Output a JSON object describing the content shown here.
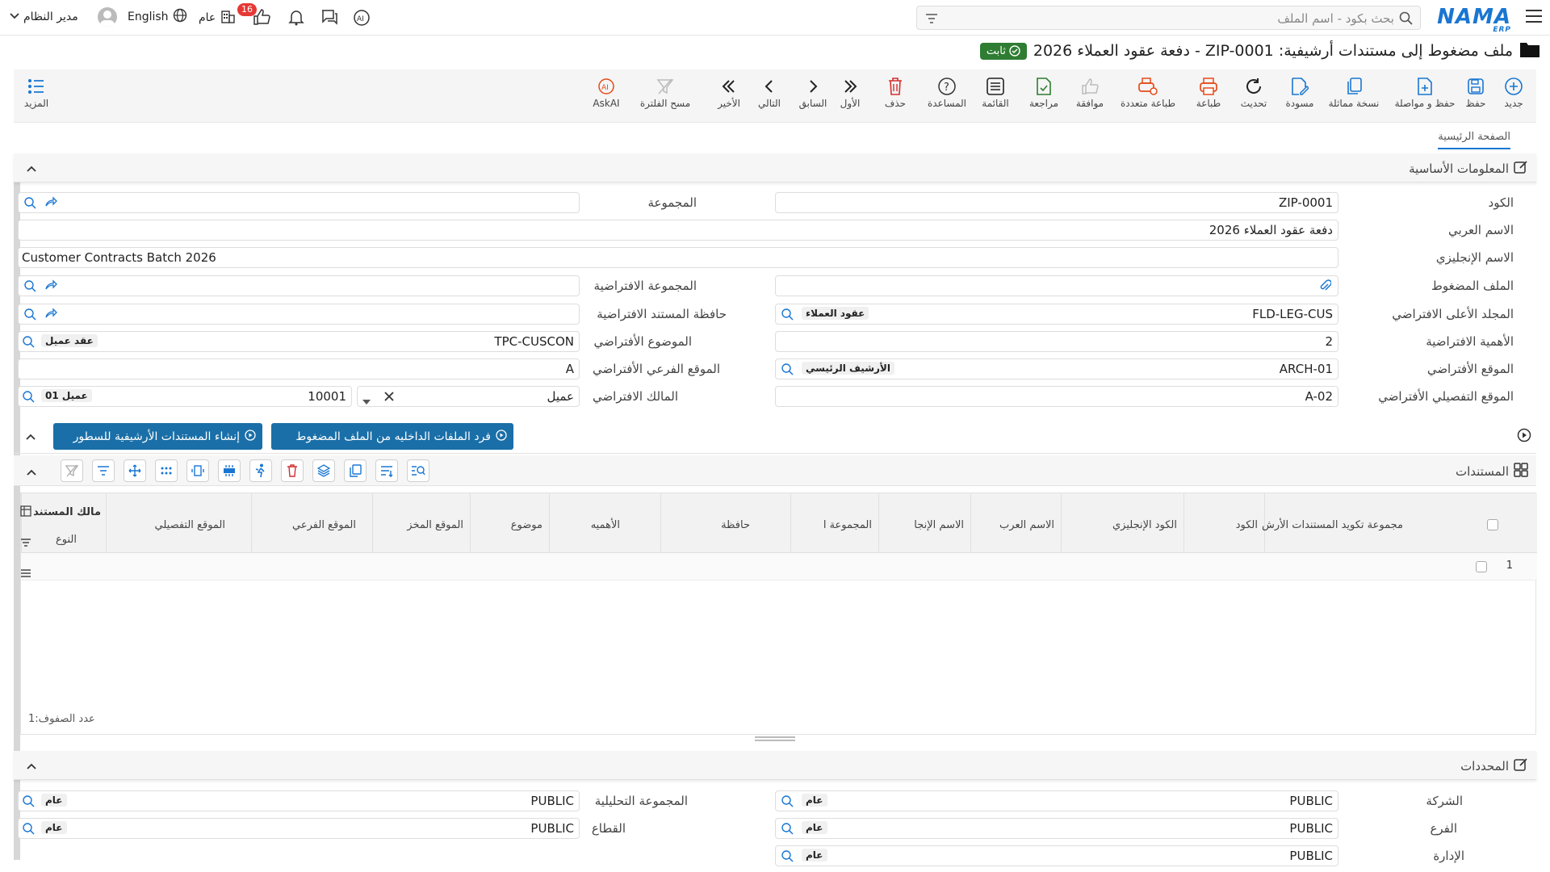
{
  "topbar": {
    "search_placeholder": "بحث بكود - اسم الملف",
    "logo": "NAMA",
    "logo_sub": "ERP",
    "user_name": "مدير النظام",
    "language": "English",
    "scope": "عام",
    "notif_count": "16"
  },
  "page": {
    "title": "ملف مضغوط إلى مستندات أرشيفية: ZIP-0001 - دفعة عقود العملاء 2026",
    "status": "ثابت"
  },
  "toolbar": {
    "new": "جديد",
    "save": "حفظ",
    "save_continue": "حفظ و مواصلة",
    "duplicate": "نسخة مماثلة",
    "draft": "مسودة",
    "refresh": "تحديث",
    "print": "طباعة",
    "multi_print": "طباعة متعددة",
    "approve": "موافقة",
    "review": "مراجعة",
    "list": "القائمة",
    "help": "المساعدة",
    "delete": "حذف",
    "first": "الأول",
    "prev": "السابق",
    "next": "التالي",
    "last": "الأخير",
    "clear_filter": "مسح الفلترة",
    "askai": "AskAI",
    "more": "المزيد"
  },
  "tabs": {
    "main": "الصفحة الرئيسية"
  },
  "basic": {
    "title": "المعلومات الأساسية",
    "code_label": "الكود",
    "code": "ZIP-0001",
    "group_label": "المجموعة",
    "arabic_name_label": "الاسم العربي",
    "arabic_name": "دفعة عقود العملاء 2026",
    "english_name_label": "الاسم الإنجليزي",
    "english_name": "Customer Contracts Batch 2026",
    "zip_file_label": "الملف المضغوط",
    "default_group_label": "المجموعة الافتراضية",
    "default_parent_folder_label": "المجلد الأعلى الافتراضي",
    "default_parent_folder": "FLD-LEG-CUS",
    "default_parent_folder_tag": "عقود العملاء",
    "default_doc_holder_label": "حافظة المستند الافتراضية",
    "default_importance_label": "الأهمية الافتراضية",
    "default_importance": "2",
    "default_subject_label": "الموضوع الأفتراضي",
    "default_subject": "TPC-CUSCON",
    "default_subject_tag": "عقد عميل",
    "default_location_label": "الموقع الأفتراضي",
    "default_location": "ARCH-01",
    "default_location_tag": "الأرشيف الرئيسي",
    "default_sublocation_label": "الموقع الفرعي الأفتراضي",
    "default_sublocation": "A",
    "default_detail_location_label": "الموقع التفصيلي الأفتراضي",
    "default_detail_location": "A-02",
    "default_owner_label": "المالك الافتراضي",
    "default_owner_type": "عميل",
    "default_owner": "10001",
    "default_owner_tag": "عميل 01"
  },
  "actions": {
    "extract": "فرد الملفات الداخليه من الملف المضغوط",
    "create_docs": "إنشاء المستندات الأرشيفية للسطور"
  },
  "documents": {
    "title": "المستندات",
    "columns": [
      "مجموعة تكويد المستندات الأرش",
      "الكود",
      "الكود الإنجليزي",
      "الاسم العرب",
      "الاسم الإنجا",
      "المجموعة ا",
      "حافظة",
      "الأهميه",
      "موضوع",
      "الموقع المخز",
      "الموقع الفرعي",
      "الموقع التفصيلي",
      "مالك المستند"
    ],
    "type_col": "النوع",
    "row_number": "1",
    "rows_count_label": "عدد الصفوف:",
    "rows_count": "1"
  },
  "dims": {
    "title": "المحددات",
    "company_label": "الشركة",
    "company": "PUBLIC",
    "company_tag": "عام",
    "branch_label": "الفرع",
    "branch": "PUBLIC",
    "branch_tag": "عام",
    "dept_label": "الإدارة",
    "dept": "PUBLIC",
    "dept_tag": "عام",
    "analytic_label": "المجموعة التحليلية",
    "analytic": "PUBLIC",
    "analytic_tag": "عام",
    "sector_label": "القطاع",
    "sector": "PUBLIC",
    "sector_tag": "عام"
  },
  "colors": {
    "accent": "#1976d2",
    "status": "#2e7d32",
    "action_button": "#1a6fa8"
  }
}
